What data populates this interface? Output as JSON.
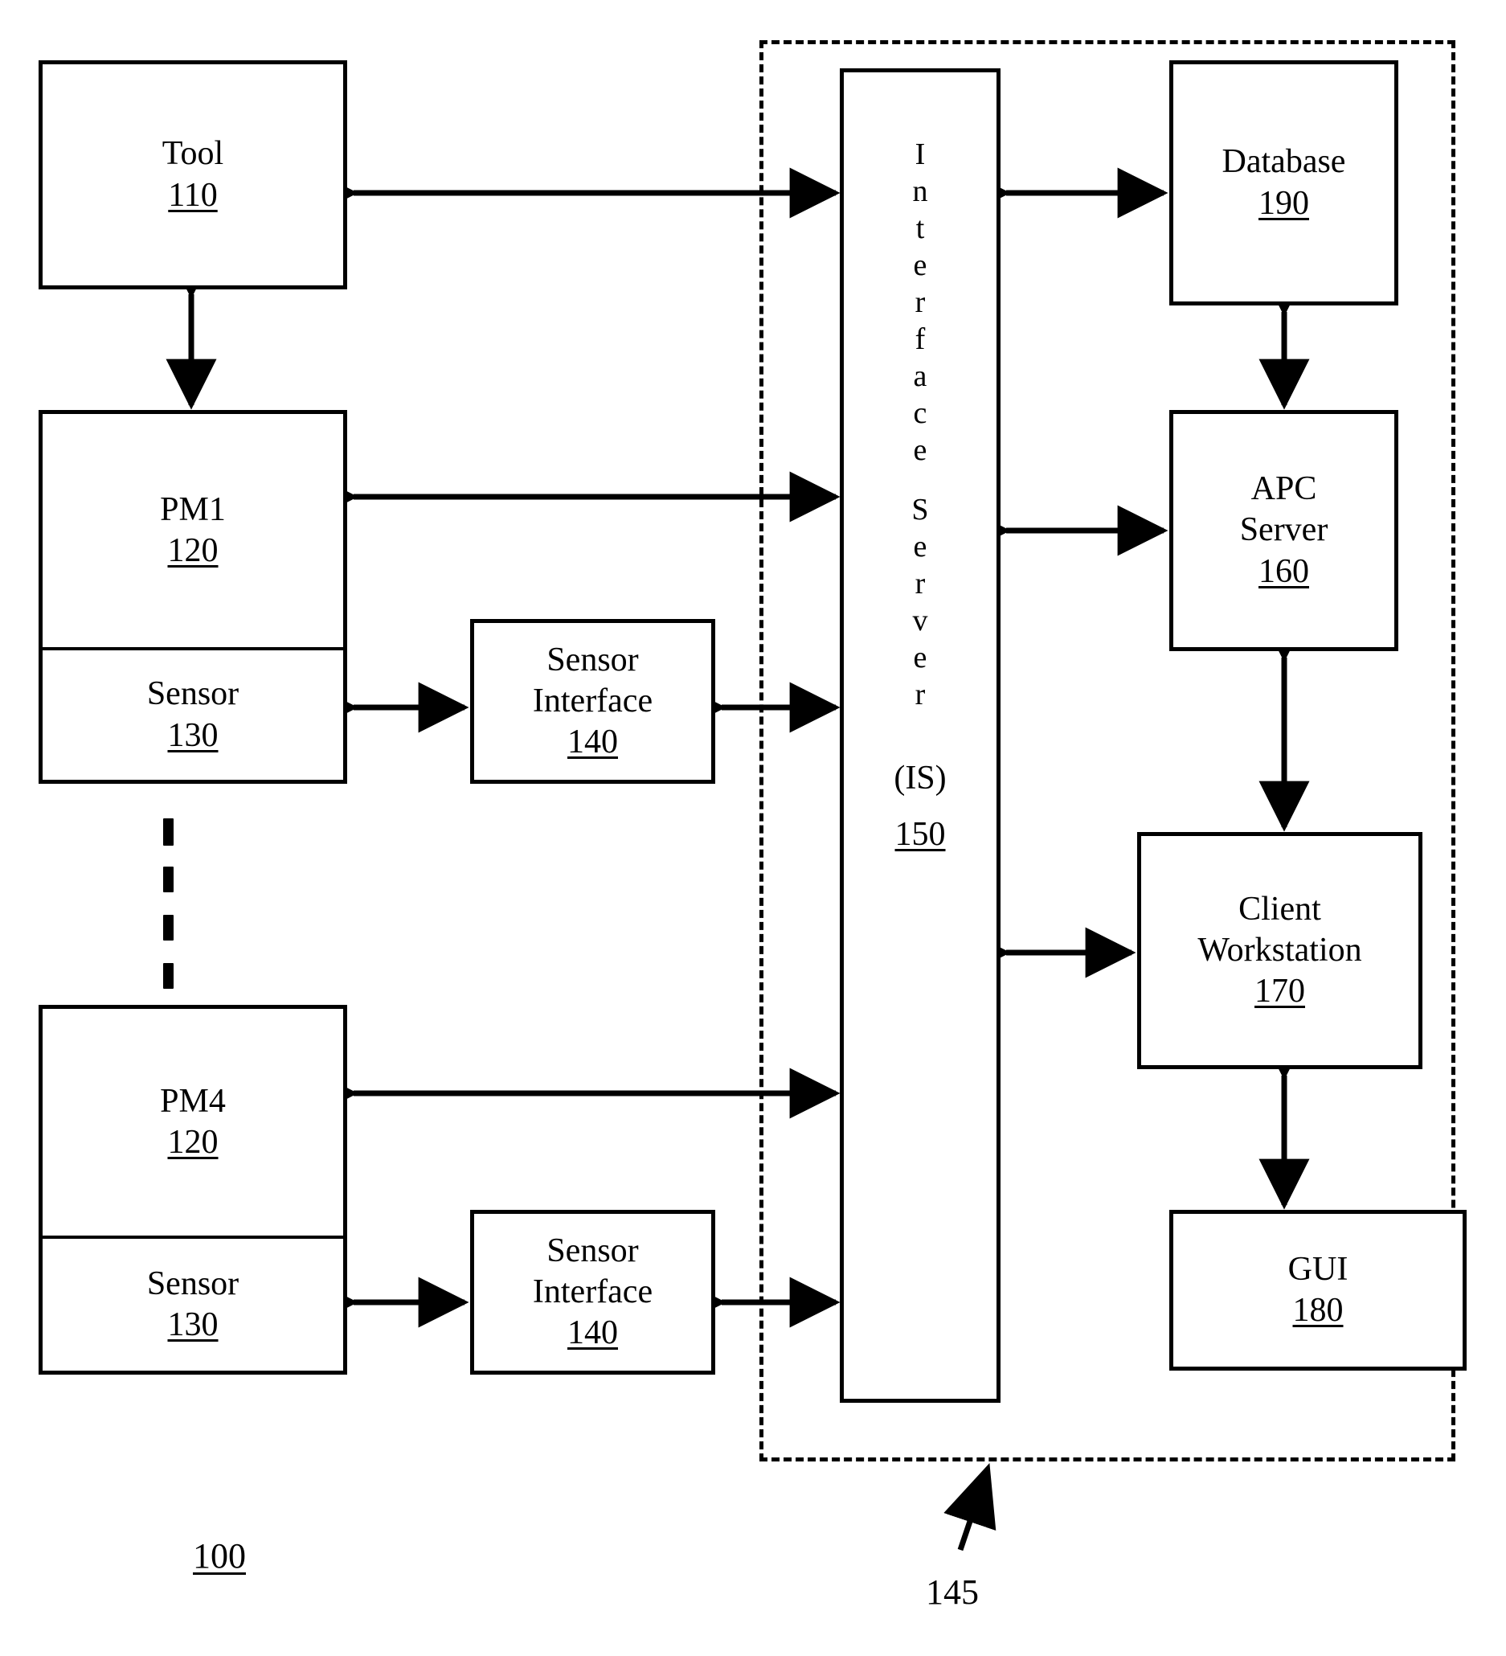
{
  "figure": {
    "system_ref": "100",
    "boundary_ref": "145"
  },
  "left_column": {
    "tool": {
      "label": "Tool",
      "ref": "110"
    },
    "pm1": {
      "module_label": "PM1",
      "module_ref": "120",
      "sensor_label": "Sensor",
      "sensor_ref": "130"
    },
    "pm4": {
      "module_label": "PM4",
      "module_ref": "120",
      "sensor_label": "Sensor",
      "sensor_ref": "130"
    },
    "ellipsis_marker": "vertical-dashed-ellipsis"
  },
  "sensor_interfaces": [
    {
      "line1": "Sensor",
      "line2": "Interface",
      "ref": "140"
    },
    {
      "line1": "Sensor",
      "line2": "Interface",
      "ref": "140"
    }
  ],
  "interface_server": {
    "vertical_title": "Interface Server",
    "word1": "Interface",
    "word2": "Server",
    "abbreviation": "(IS)",
    "ref": "150"
  },
  "right_column": {
    "database": {
      "label": "Database",
      "ref": "190"
    },
    "apc_server": {
      "line1": "APC",
      "line2": "Server",
      "ref": "160"
    },
    "client_workstation": {
      "line1": "Client",
      "line2": "Workstation",
      "ref": "170"
    },
    "gui": {
      "label": "GUI",
      "ref": "180"
    }
  },
  "colors": {
    "stroke": "#000000",
    "background": "#ffffff"
  }
}
